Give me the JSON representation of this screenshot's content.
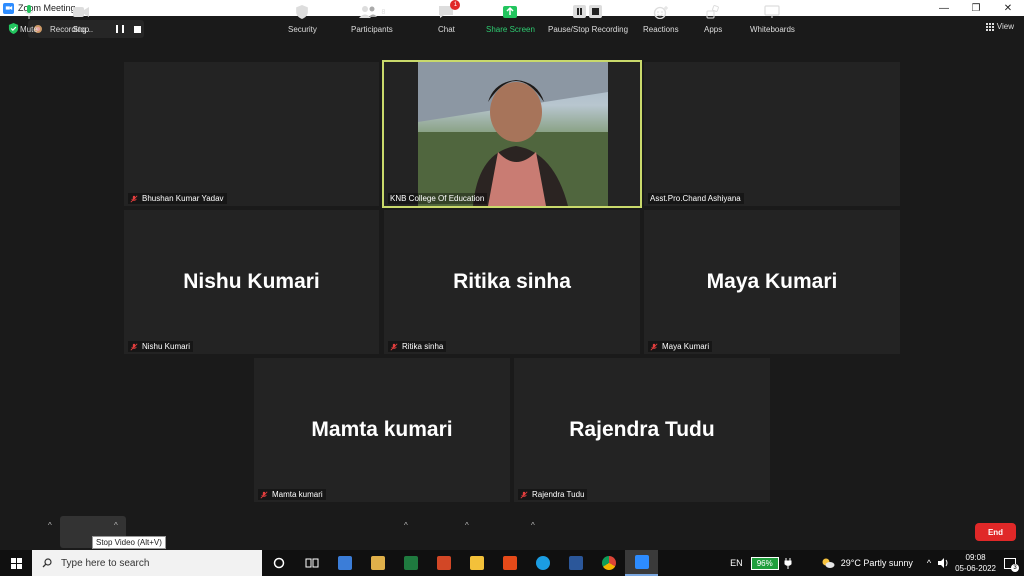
{
  "window": {
    "title": "Zoom Meeting",
    "minimize": "—",
    "restore": "❐",
    "close": "✕"
  },
  "topbar": {
    "recording_text": "Recording...",
    "view_label": "View"
  },
  "tiles": [
    {
      "name": "Bhushan Kumar Yadav",
      "big": ""
    },
    {
      "name": "KNB College Of Education",
      "big": ""
    },
    {
      "name": "Asst.Pro.Chand Ashiyana",
      "big": ""
    },
    {
      "name": "Nishu Kumari",
      "big": "Nishu Kumari"
    },
    {
      "name": "Ritika sinha",
      "big": "Ritika sinha"
    },
    {
      "name": "Maya Kumari",
      "big": "Maya Kumari"
    },
    {
      "name": "Mamta kumari",
      "big": "Mamta kumari"
    },
    {
      "name": "Rajendra Tudu",
      "big": "Rajendra Tudu"
    }
  ],
  "toolbar": {
    "mute": "Mute",
    "stop_video": "Stop",
    "tooltip": "Stop Video (Alt+V)",
    "security": "Security",
    "participants": "Participants",
    "participants_count": "8",
    "chat": "Chat",
    "chat_badge": "1",
    "share": "Share Screen",
    "recording": "Pause/Stop Recording",
    "reactions": "Reactions",
    "apps": "Apps",
    "whiteboards": "Whiteboards",
    "end": "End"
  },
  "taskbar": {
    "search_placeholder": "Type here to search",
    "lang": "EN",
    "battery": "96%",
    "weather": "29°C  Partly sunny",
    "time": "09:08",
    "date": "05-06-2022",
    "notifications": "3"
  },
  "colors": {
    "active_speaker": "#c9d96b",
    "end_button": "#e02828",
    "share_green": "#2ecc71"
  }
}
